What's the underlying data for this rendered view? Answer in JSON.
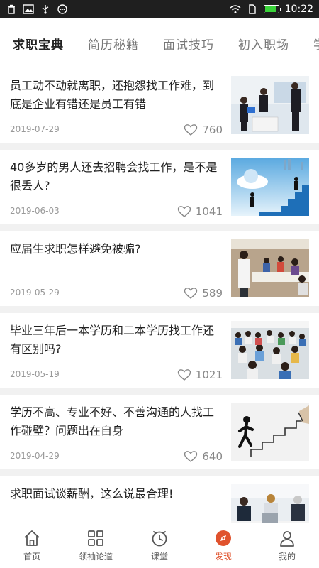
{
  "status_bar": {
    "time": "10:22",
    "icons": [
      "trash-icon",
      "image-icon",
      "usb-icon",
      "message-icon",
      "wifi-icon",
      "sim-icon",
      "battery-icon"
    ],
    "battery_color": "#3ad33a"
  },
  "tabs": [
    {
      "label": "求职宝典",
      "active": true
    },
    {
      "label": "简历秘籍",
      "active": false
    },
    {
      "label": "面试技巧",
      "active": false
    },
    {
      "label": "初入职场",
      "active": false
    },
    {
      "label": "学",
      "active": false
    }
  ],
  "articles": [
    {
      "title": "员工动不动就离职，还抱怨找工作难，到底是企业有错还是员工有错",
      "date": "2019-07-29",
      "likes": "760"
    },
    {
      "title": "40多岁的男人还去招聘会找工作，是不是很丢人?",
      "date": "2019-06-03",
      "likes": "1041"
    },
    {
      "title": "应届生求职怎样避免被骗?",
      "date": "2019-05-29",
      "likes": "589"
    },
    {
      "title": "毕业三年后一本学历和二本学历找工作还有区别吗?",
      "date": "2019-05-19",
      "likes": "1021"
    },
    {
      "title": "学历不高、专业不好、不善沟通的人找工作碰壁？问题出在自身",
      "date": "2019-04-29",
      "likes": "640"
    },
    {
      "title": "求职面试谈薪酬，这么说最合理!",
      "date": "",
      "likes": ""
    }
  ],
  "nav": [
    {
      "label": "首页",
      "icon": "home-icon",
      "active": false
    },
    {
      "label": "领袖论道",
      "icon": "grid-icon",
      "active": false
    },
    {
      "label": "课堂",
      "icon": "clock-icon",
      "active": false
    },
    {
      "label": "发现",
      "icon": "discover-icon",
      "active": true
    },
    {
      "label": "我的",
      "icon": "profile-icon",
      "active": false
    }
  ],
  "colors": {
    "accent": "#e0522d",
    "active_tab": "#222222",
    "inactive_tab": "#777777"
  }
}
